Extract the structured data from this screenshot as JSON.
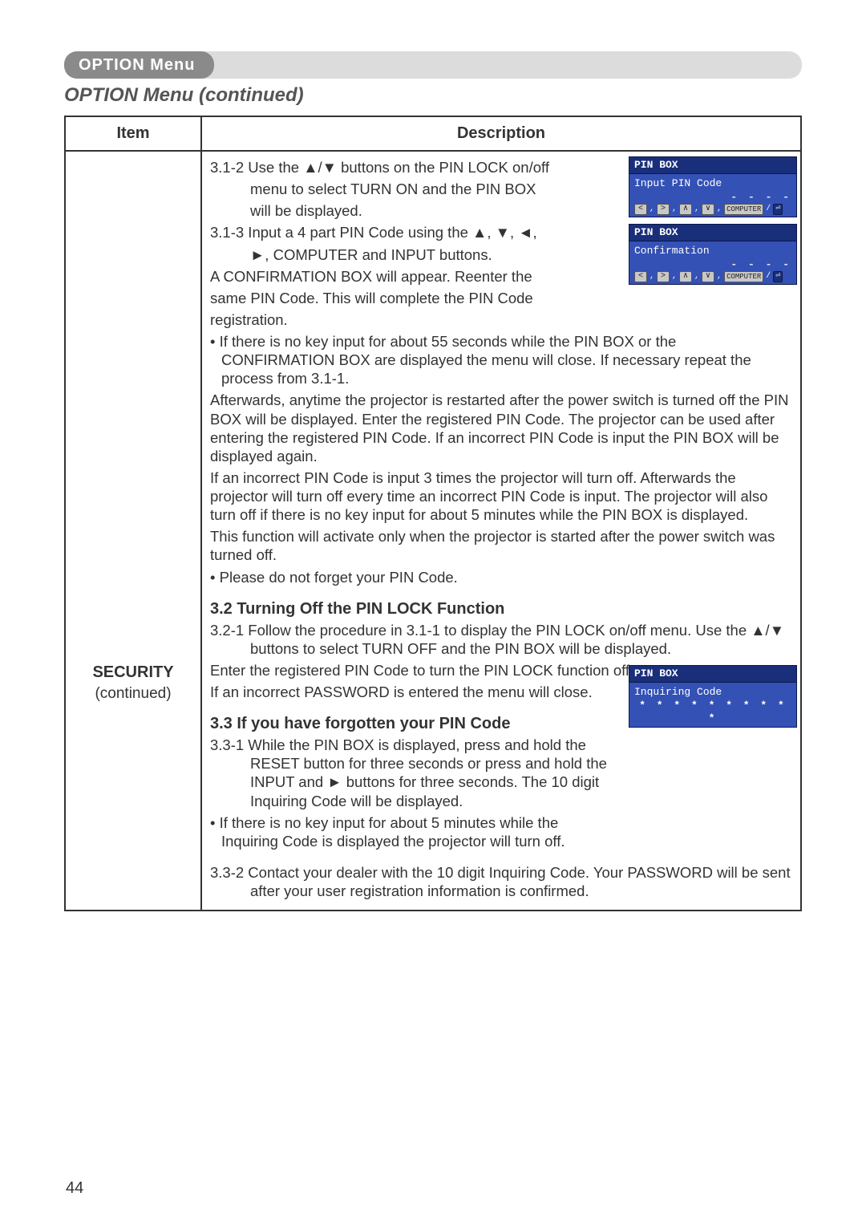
{
  "menu_tab": "OPTION Menu",
  "section_heading": "OPTION Menu (continued)",
  "table": {
    "head_item": "Item",
    "head_desc": "Description",
    "item_title": "SECURITY",
    "item_sub": "(continued)"
  },
  "desc": {
    "l312a": "3.1-2 Use the ▲/▼ buttons on the PIN LOCK on/off",
    "l312b": "menu to select TURN ON and the PIN BOX",
    "l312c": "will be displayed.",
    "l313a": "3.1-3   Input a 4 part PIN Code using the ▲, ▼, ◄,",
    "l313b": "►, COMPUTER and INPUT buttons.",
    "confirmA": "A CONFIRMATION BOX will appear. Reenter the",
    "confirmB": "same PIN Code. This will complete the PIN Code",
    "confirmC": "registration.",
    "bullet1": "• If there is no key input for about 55 seconds while the PIN BOX or the CONFIRMATION BOX are displayed the menu will close. If necessary repeat the process from 3.1-1.",
    "after1": "Afterwards, anytime the projector is restarted after the power switch is turned off the PIN BOX will be displayed. Enter the registered PIN Code. The projector can be used after entering the registered PIN Code. If an incorrect PIN Code is input the PIN BOX will be displayed again.",
    "after2": "If an incorrect PIN Code is input 3 times the projector will turn off. Afterwards the projector will turn off every time an incorrect PIN Code is input. The projector will also turn off if there is no key input for about 5 minutes while the PIN BOX is displayed.",
    "after3": "This function will activate only when the projector is started after the power switch was turned off.",
    "bullet2": "• Please do not forget your PIN Code.",
    "h32": "3.2 Turning Off the PIN LOCK Function",
    "l321": "3.2-1 Follow the procedure in 3.1-1 to display the PIN LOCK on/off menu. Use the ▲/▼ buttons to select TURN OFF and the PIN BOX will be displayed.",
    "l32a": "Enter the registered PIN Code to turn the PIN LOCK function off.",
    "l32b": "If an incorrect PASSWORD is entered the menu will close.",
    "h33": "3.3 If you have forgotten your PIN Code",
    "l331": "3.3-1 While the PIN BOX is displayed, press and hold the RESET button for three seconds or press and hold the INPUT and ► buttons for three seconds. The 10 digit Inquiring Code will be displayed.",
    "bullet3": "• If there is no key input for about 5 minutes while the Inquiring Code is displayed the projector will turn off.",
    "l332": "3.3-2 Contact your dealer with the 10 digit Inquiring Code. Your PASSWORD will be sent after your user registration information is confirmed."
  },
  "pin_input": {
    "title": "PIN BOX",
    "label": "Input PIN Code",
    "dashes": "- - - -",
    "btn_left": "<",
    "btn_right": ">",
    "btn_up": "∧",
    "btn_down": "∨",
    "btn_comp": "COMPUTER",
    "btn_end": "⏎"
  },
  "pin_confirm": {
    "title": "PIN BOX",
    "label": "Confirmation",
    "dashes": "- - - -"
  },
  "pin_inquire": {
    "title": "PIN BOX",
    "label": "Inquiring Code",
    "code": "* *  * * * *  * * * *"
  },
  "page_number": "44"
}
